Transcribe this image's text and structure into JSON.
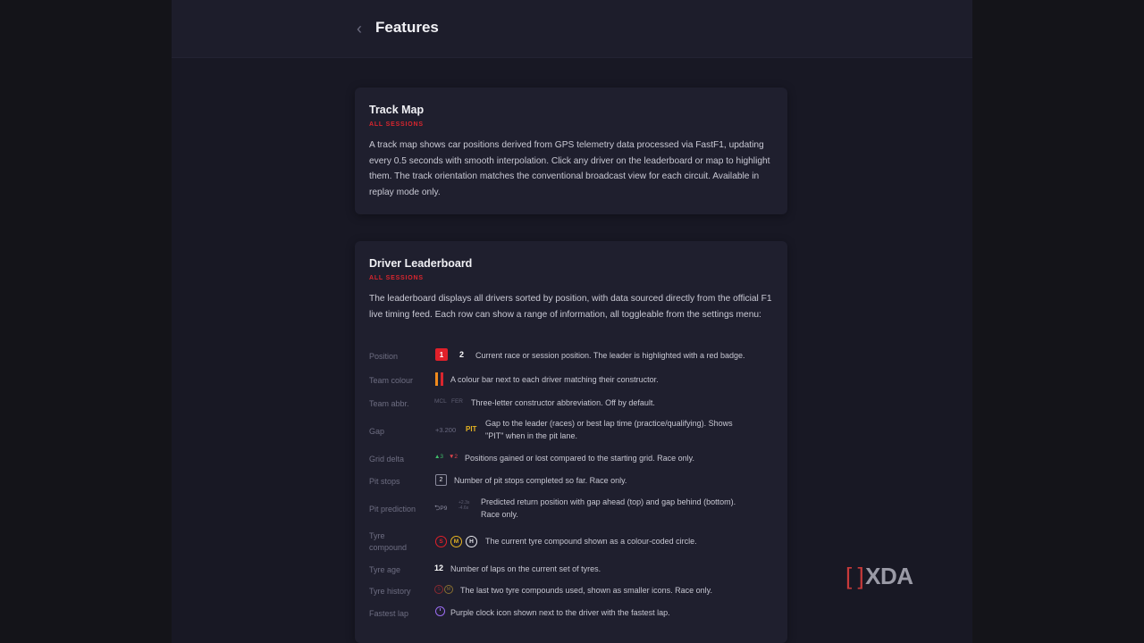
{
  "header": {
    "title": "Features",
    "back_icon": "chevron-left-icon"
  },
  "cards": [
    {
      "title": "Track Map",
      "badge": "ALL SESSIONS",
      "description": "A track map shows car positions derived from GPS telemetry data processed via FastF1, updating every 0.5 seconds with smooth interpolation. Click any driver on the leaderboard or map to highlight them. The track orientation matches the conventional broadcast view for each circuit. Available in replay mode only."
    },
    {
      "title": "Driver Leaderboard",
      "badge": "ALL SESSIONS",
      "description": "The leaderboard displays all drivers sorted by position, with data sourced directly from the official F1 live timing feed. Each row can show a range of information, all toggleable from the settings menu:",
      "rows": [
        {
          "label": "Position",
          "text": "Current race or session position. The leader is highlighted with a red badge.",
          "badge1": "1",
          "badge2": "2"
        },
        {
          "label": "Team colour",
          "text": "A colour bar next to each driver matching their constructor."
        },
        {
          "label": "Team abbr.",
          "text": "Three-letter constructor abbreviation. Off by default.",
          "abbr1": "MCL",
          "abbr2": "FER"
        },
        {
          "label": "Gap",
          "text_line1": "Gap to the leader (races) or best lap time (practice/qualifying). Shows",
          "text_line2": "\"PIT\" when in the pit lane.",
          "gap": "+3.200",
          "pit": "PIT"
        },
        {
          "label": "Grid delta",
          "text": "Positions gained or lost compared to the starting grid. Race only.",
          "up": "▲3",
          "down": "▼2"
        },
        {
          "label": "Pit stops",
          "text": "Number of pit stops completed so far. Race only.",
          "count": "2"
        },
        {
          "label": "Pit prediction",
          "text_line1": "Predicted return position with gap ahead (top) and gap behind (bottom).",
          "text_line2": "Race only.",
          "pred": "P9",
          "gap_top": "+2.3s",
          "gap_bottom": "-4.6s"
        },
        {
          "label_line1": "Tyre",
          "label_line2": "compound",
          "text": "The current tyre compound shown as a colour-coded circle.",
          "tyres": [
            "S",
            "M",
            "H"
          ]
        },
        {
          "label": "Tyre age",
          "text": "Number of laps on the current set of tyres.",
          "age": "12"
        },
        {
          "label": "Tyre history",
          "text": "The last two tyre compounds used, shown as smaller icons. Race only.",
          "hist": [
            "S",
            "M"
          ]
        },
        {
          "label": "Fastest lap",
          "text": "Purple clock icon shown next to the driver with the fastest lap."
        }
      ]
    }
  ],
  "colors": {
    "accent_red": "#d9262e",
    "soft": "#e0202a",
    "medium": "#e6b422",
    "hard": "#e8e8ee",
    "fastest_purple": "#9a6cf0",
    "team_orange": "#f08a1c",
    "team_red": "#d9262e"
  },
  "watermark": {
    "bracket": "[ ]",
    "text": "XDA"
  }
}
